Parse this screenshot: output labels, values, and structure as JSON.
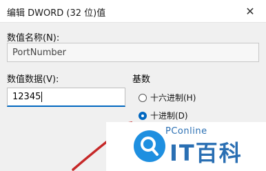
{
  "window": {
    "title": "编辑 DWORD (32 位)值",
    "close_glyph": "✕"
  },
  "value_name": {
    "label": "数值名称(N):",
    "value": "PortNumber"
  },
  "value_data": {
    "label": "数值数据(V):",
    "value": "12345"
  },
  "base": {
    "title": "基数",
    "options": [
      {
        "label": "十六进制(H)",
        "checked": false
      },
      {
        "label": "十进制(D)",
        "checked": true
      }
    ]
  },
  "watermark": {
    "line1": "PConline",
    "line2": "IT百科"
  },
  "colors": {
    "accent": "#0067c0",
    "annotation_arrow": "#c62828",
    "watermark_blue": "#1e8fe0"
  }
}
